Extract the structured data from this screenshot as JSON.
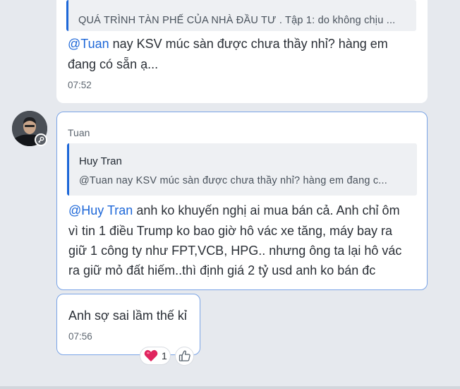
{
  "conversation": {
    "message1": {
      "quote_text": "QUÁ TRÌNH TÀN PHẾ CỦA NHÀ ĐẦU TƯ . Tập 1: do không chịu ...",
      "mention": "@Tuan",
      "text_line1": " nay KSV múc sàn được chưa thầy nhỉ? hàng em",
      "text_line2": "đang có sẵn ạ...",
      "time": "07:52"
    },
    "message2": {
      "sender": "Tuan",
      "quote_author": "Huy Tran",
      "quote_text": "@Tuan nay KSV múc sàn được chưa thầy nhỉ? hàng em đang c...",
      "mention": "@Huy Tran",
      "text_line1": "  anh ko khuyến nghị ai mua bán cả. Anh chỉ ôm",
      "text_line2": "vì tin 1 điều Trump ko bao giờ  hô vác xe tăng, máy bay ra",
      "text_line3": "giữ 1 công ty như FPT,VCB, HPG.. nhưng ông ta lại hô vác",
      "text_line4": "ra giữ mỏ đất hiếm..thì định giá 2 tỷ usd anh ko bán đc"
    },
    "message3": {
      "text": "Anh sợ sai lầm thế kỉ",
      "time": "07:56",
      "reaction_count": "1"
    }
  },
  "icons": {
    "avatar": "avatar",
    "key_badge": "key-icon",
    "reaction": "heart-icon",
    "like": "thumbs-up-icon"
  },
  "colors": {
    "mention": "#1d67d8",
    "heart": "#e0245e",
    "selected_border": "#7aa4e6",
    "background": "#e6e9ee"
  }
}
